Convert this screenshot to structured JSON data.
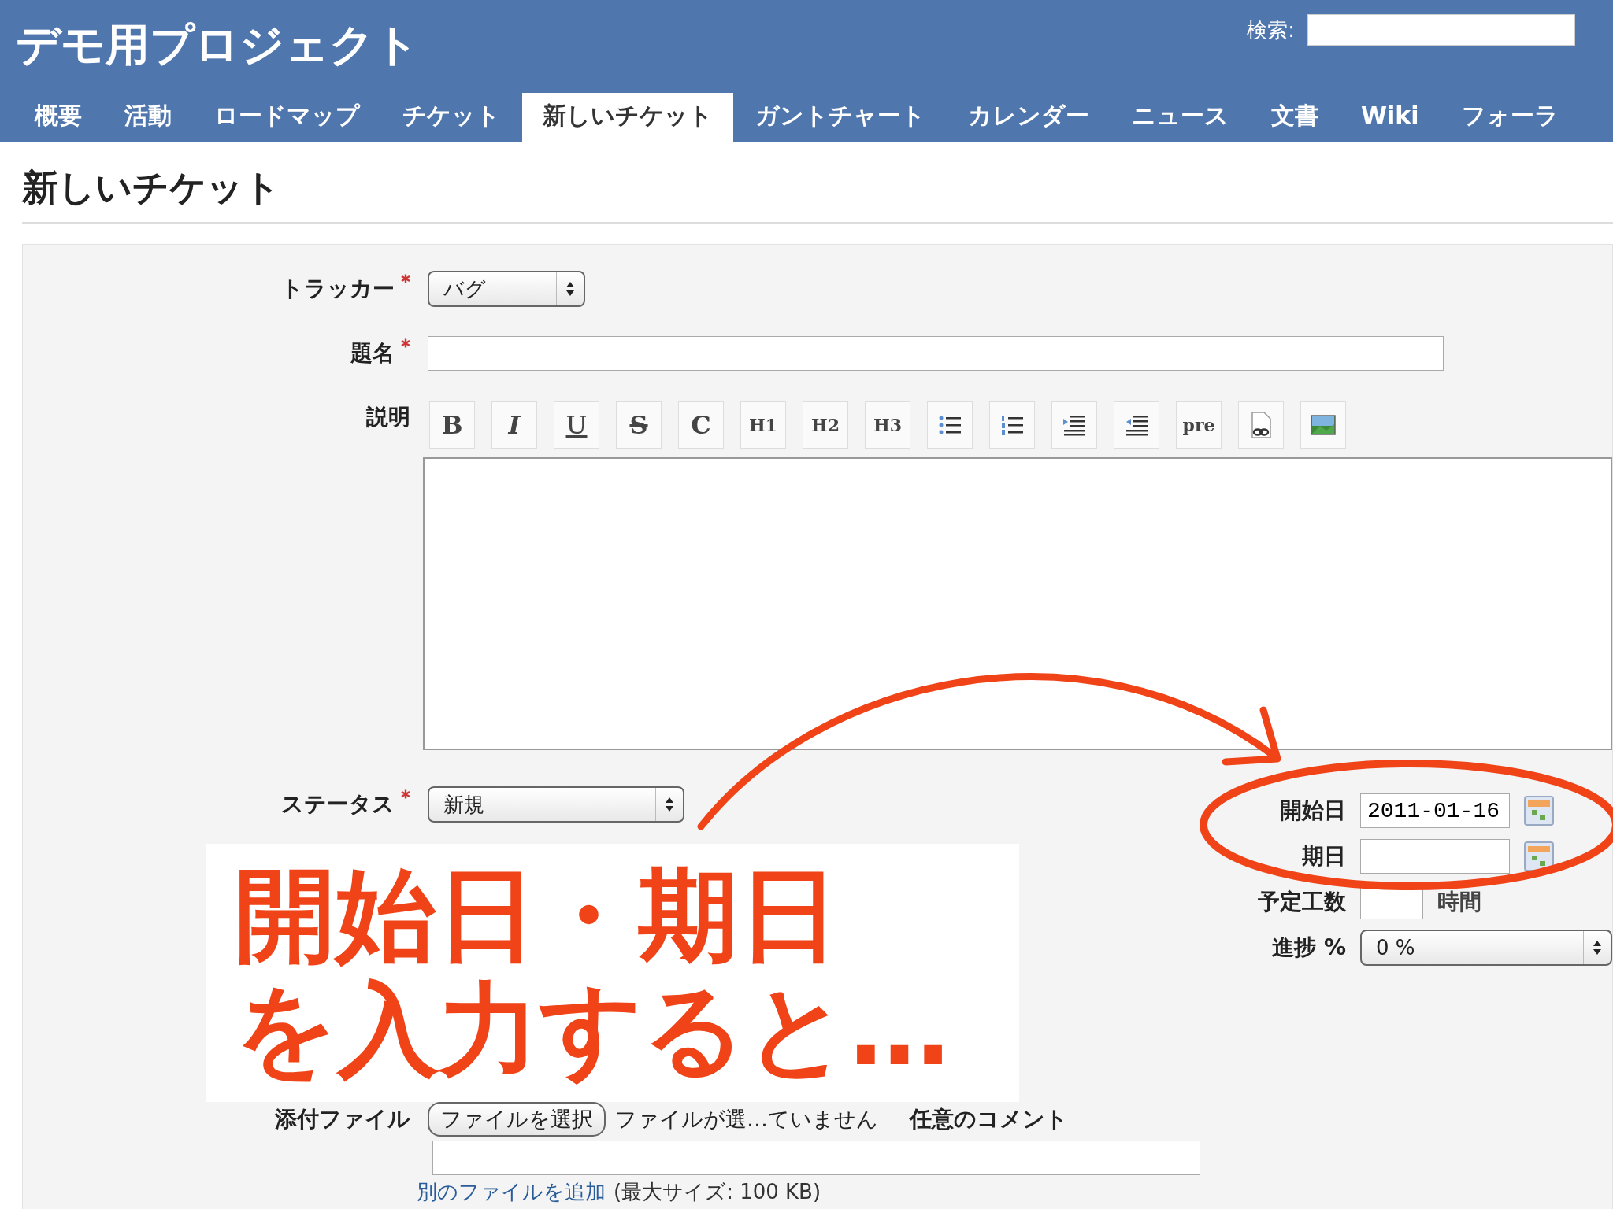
{
  "header": {
    "title": "デモ用プロジェクト",
    "search_label": "検索:"
  },
  "tabs": [
    {
      "label": "概要",
      "selected": false
    },
    {
      "label": "活動",
      "selected": false
    },
    {
      "label": "ロードマップ",
      "selected": false
    },
    {
      "label": "チケット",
      "selected": false
    },
    {
      "label": "新しいチケット",
      "selected": true
    },
    {
      "label": "ガントチャート",
      "selected": false
    },
    {
      "label": "カレンダー",
      "selected": false
    },
    {
      "label": "ニュース",
      "selected": false
    },
    {
      "label": "文書",
      "selected": false
    },
    {
      "label": "Wiki",
      "selected": false
    },
    {
      "label": "フォーラ",
      "selected": false
    }
  ],
  "page_title": "新しいチケット",
  "form": {
    "tracker": {
      "label": "トラッカー",
      "required": true,
      "value": "バグ"
    },
    "subject": {
      "label": "題名",
      "required": true
    },
    "description": {
      "label": "説明",
      "toolbar": [
        {
          "kind": "bold",
          "label": "B"
        },
        {
          "kind": "italic",
          "label": "I"
        },
        {
          "kind": "underline",
          "label": "U"
        },
        {
          "kind": "strike",
          "label": "S"
        },
        {
          "kind": "code",
          "label": "C"
        },
        {
          "kind": "text",
          "label": "H1"
        },
        {
          "kind": "text",
          "label": "H2"
        },
        {
          "kind": "text",
          "label": "H3"
        },
        {
          "kind": "ul"
        },
        {
          "kind": "ol"
        },
        {
          "kind": "indent"
        },
        {
          "kind": "outdent"
        },
        {
          "kind": "text",
          "label": "pre"
        },
        {
          "kind": "file"
        },
        {
          "kind": "image"
        }
      ]
    },
    "status": {
      "label": "ステータス",
      "required": true,
      "value": "新規"
    },
    "start_date": {
      "label": "開始日",
      "value": "2011-01-16"
    },
    "due_date": {
      "label": "期日"
    },
    "estimated_hours": {
      "label": "予定工数",
      "unit": "時間"
    },
    "done_ratio": {
      "label": "進捗 %",
      "value": "0 %"
    }
  },
  "attachments": {
    "label": "添付ファイル",
    "button": "ファイルを選択",
    "status": "ファイルが選…ていません",
    "comment_label": "任意のコメント",
    "add_link": "別のファイルを追加",
    "size_note": "(最大サイズ: 100 KB)"
  },
  "annotation": {
    "caption_lines": [
      "開始日・期日",
      "を入力すると…"
    ]
  }
}
